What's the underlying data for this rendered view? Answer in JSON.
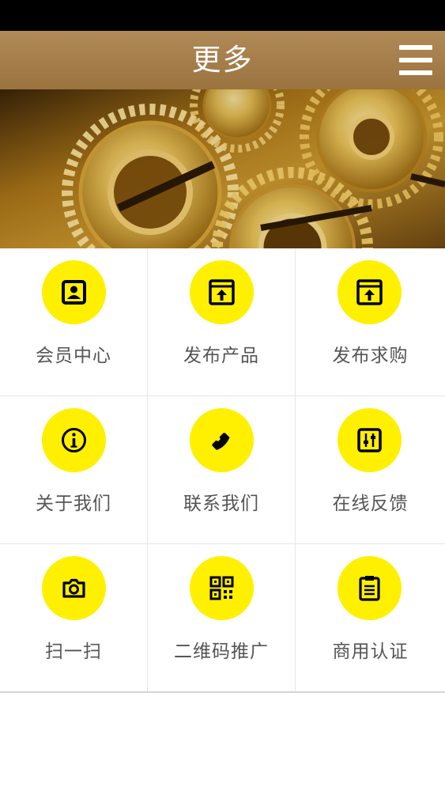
{
  "header": {
    "title": "更多",
    "menu_icon": "hamburger-menu-icon"
  },
  "banner": {
    "image": "golden-gears-photo"
  },
  "grid": {
    "items": [
      {
        "label": "会员中心",
        "icon": "member-card-icon"
      },
      {
        "label": "发布产品",
        "icon": "upload-window-icon"
      },
      {
        "label": "发布求购",
        "icon": "upload-window-icon"
      },
      {
        "label": "关于我们",
        "icon": "info-icon"
      },
      {
        "label": "联系我们",
        "icon": "phone-icon"
      },
      {
        "label": "在线反馈",
        "icon": "sliders-icon"
      },
      {
        "label": "扫一扫",
        "icon": "camera-icon"
      },
      {
        "label": "二维码推广",
        "icon": "qr-code-icon"
      },
      {
        "label": "商用认证",
        "icon": "clipboard-icon"
      }
    ]
  },
  "colors": {
    "header_bg": "#a57d4a",
    "icon_circle": "#fff000",
    "label_text": "#555555"
  }
}
